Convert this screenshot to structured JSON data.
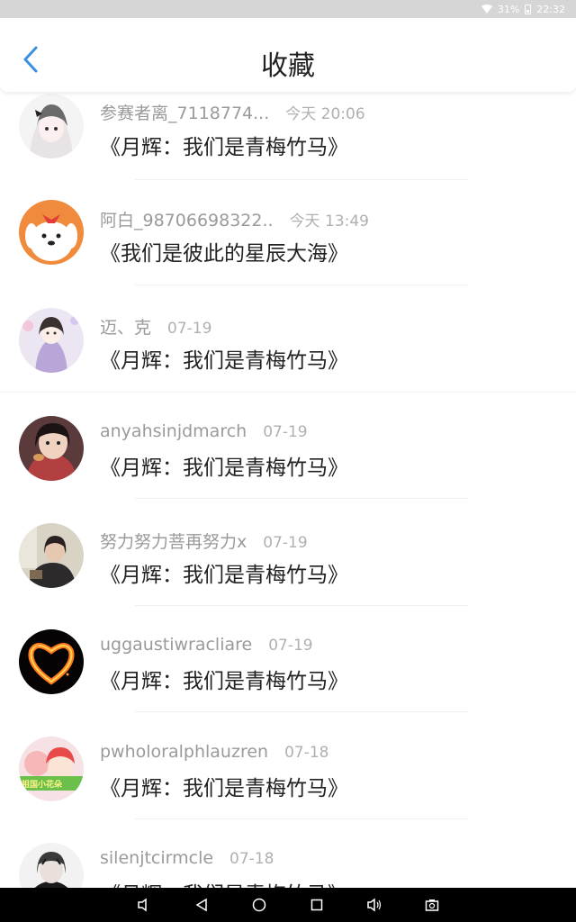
{
  "status_bar": {
    "battery": "31%",
    "time": "22:32"
  },
  "header": {
    "title": "收藏"
  },
  "items": [
    {
      "name": "参赛者离_7118774...",
      "time": "今天 20:06",
      "title": "《月辉：我们是青梅竹马》"
    },
    {
      "name": "阿白_98706698322..",
      "time": "今天 13:49",
      "title": "《我们是彼此的星辰大海》"
    },
    {
      "name": "迈、克",
      "time": "07-19",
      "title": "《月辉：我们是青梅竹马》"
    },
    {
      "name": "anyahsinjdmarch",
      "time": "07-19",
      "title": "《月辉：我们是青梅竹马》"
    },
    {
      "name": "努力努力菩再努力x",
      "time": "07-19",
      "title": "《月辉：我们是青梅竹马》"
    },
    {
      "name": "uggaustiwracliare",
      "time": "07-19",
      "title": "《月辉：我们是青梅竹马》"
    },
    {
      "name": "pwholoralphlauzren",
      "time": "07-18",
      "title": "《月辉：我们是青梅竹马》"
    },
    {
      "name": "silenjtcirmcle",
      "time": "07-18",
      "title": "《月辉：我们是青梅竹马》"
    }
  ],
  "avatar_badges": {
    "item6": "祖国小花朵"
  },
  "colors": {
    "accent": "#3b8fe0",
    "name_gray": "#9a9a9a",
    "status_bar": "#d6d6d6"
  }
}
